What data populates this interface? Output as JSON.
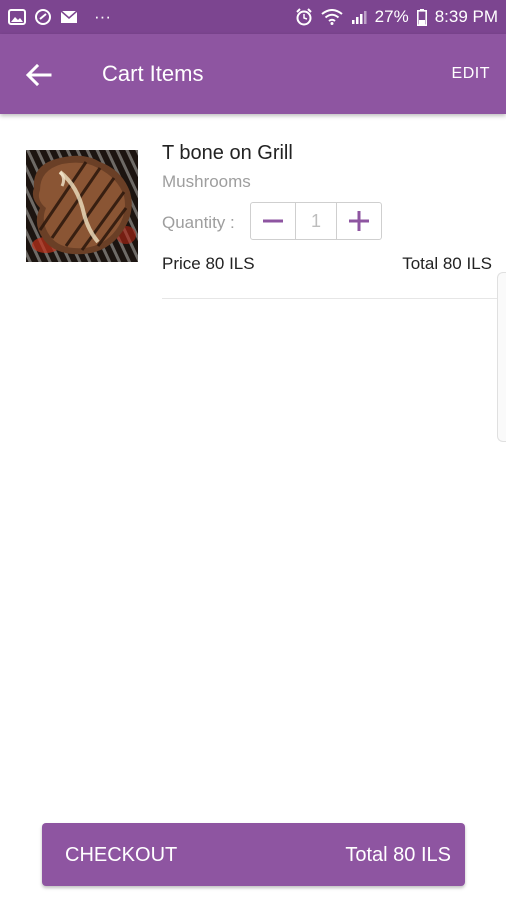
{
  "status_bar": {
    "battery": "27%",
    "time": "8:39 PM",
    "more": "···"
  },
  "app_bar": {
    "title": "Cart Items",
    "edit_label": "EDIT"
  },
  "cart": {
    "items": [
      {
        "name": "T bone on Grill",
        "option": "Mushrooms",
        "quantity_label": "Quantity :",
        "quantity": "1",
        "price": "Price 80 ILS",
        "total": "Total 80 ILS"
      }
    ]
  },
  "checkout": {
    "label": "CHECKOUT",
    "total": "Total 80 ILS"
  },
  "colors": {
    "status_bar": "#7c4590",
    "primary": "#8e55a1"
  },
  "icons": [
    "gallery-icon",
    "sync-icon",
    "mail-icon",
    "alarm-icon",
    "wifi-icon",
    "signal-icon",
    "battery-icon",
    "back-arrow-icon",
    "minus-icon",
    "plus-icon"
  ]
}
